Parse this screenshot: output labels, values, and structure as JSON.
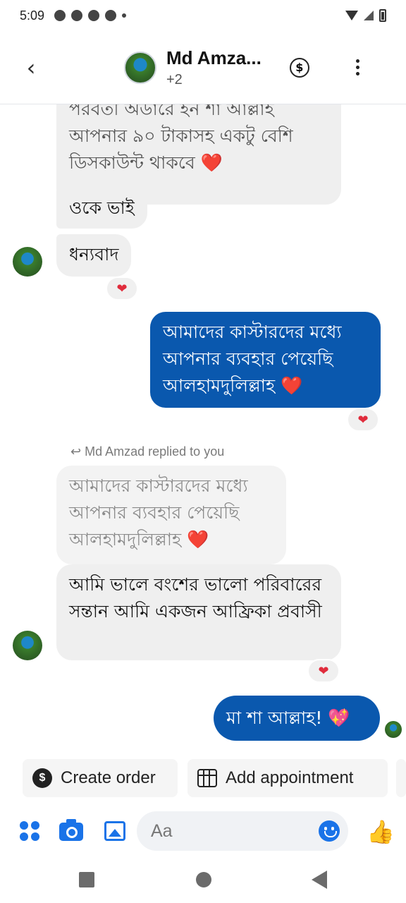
{
  "status_bar": {
    "time": "5:09"
  },
  "header": {
    "back_icon": "chevron-left-icon",
    "contact_name": "Md Amza...",
    "participants_extra": "+2",
    "dollar_icon": "$",
    "more_icon": "more-vertical-icon"
  },
  "messages": [
    {
      "text": "পরবর্তী অর্ডারে ইন শা আল্লাহ আপনার ৯০ টাকাসহ একটু বেশি ডিসকাউন্ট থাকবে",
      "emoji": "❤️"
    },
    {
      "text": "ওকে ভাই"
    },
    {
      "text": "ধন্যবাদ",
      "reaction": "❤"
    },
    {
      "text": "আমাদের কাস্টারদের মধ্যে আপনার ব্যবহার পেয়েছি আলহামদুলিল্লাহ",
      "emoji": "❤️",
      "reaction": "❤"
    },
    {
      "reply_label": "Md Amzad replied to you"
    },
    {
      "text": "আমাদের কাস্টারদের মধ্যে আপনার ব্যবহার পেয়েছি আলহামদুলিল্লাহ",
      "emoji": "❤️"
    },
    {
      "text": "আমি ভালে বংশের ভালো পরিবারের সন্তান আমি একজন আফ্রিকা প্রবাসী",
      "reaction": "❤"
    },
    {
      "text": "মা শা আল্লাহ!",
      "emoji": "💖"
    }
  ],
  "quick_actions": {
    "create_order": "Create order",
    "add_appointment": "Add appointment"
  },
  "composer": {
    "placeholder": "Aa"
  },
  "colors": {
    "outgoing_bubble": "#0a58ae",
    "incoming_bubble": "#efefef",
    "accent": "#1a73e8",
    "heart": "#e02c3c"
  }
}
